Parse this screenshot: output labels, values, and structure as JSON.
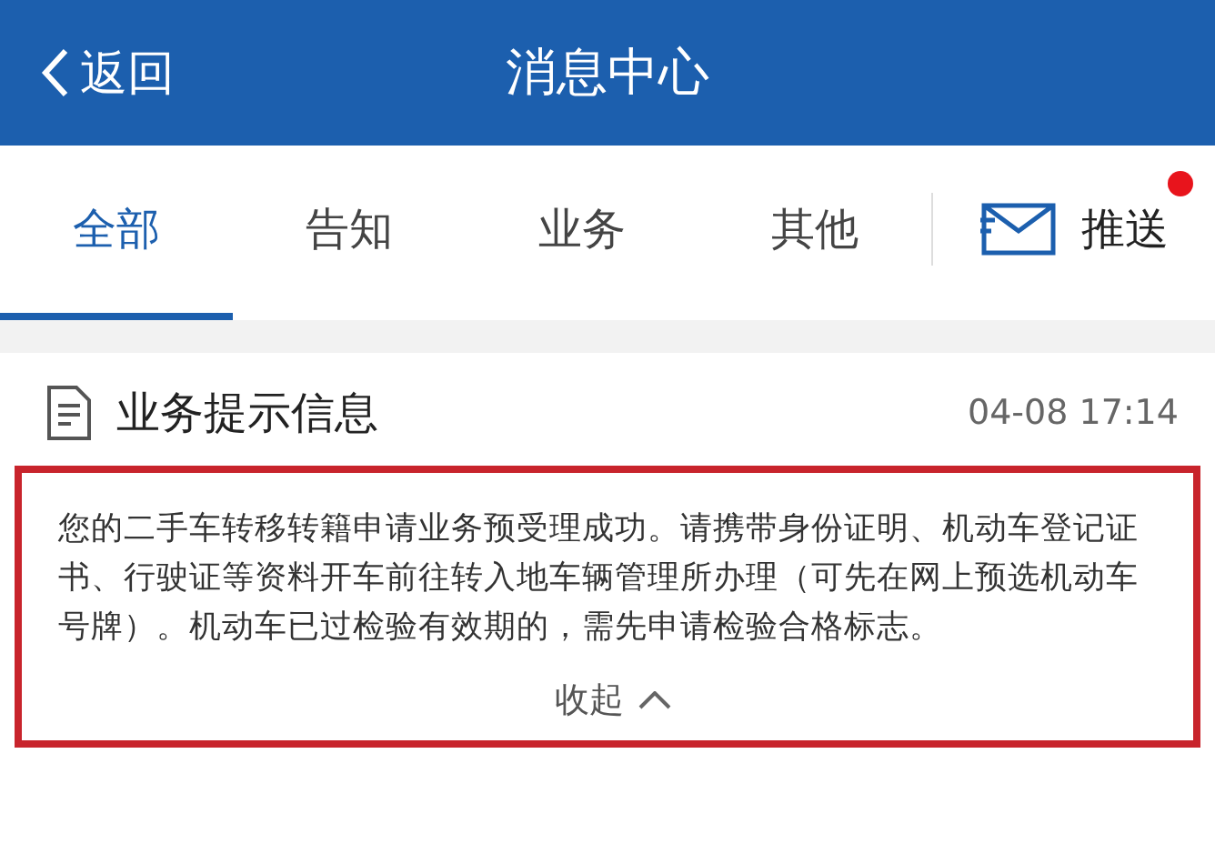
{
  "header": {
    "back": "返回",
    "title": "消息中心"
  },
  "tabs": [
    {
      "label": "全部",
      "selected": true
    },
    {
      "label": "告知",
      "selected": false
    },
    {
      "label": "业务",
      "selected": false
    },
    {
      "label": "其他",
      "selected": false
    }
  ],
  "push": {
    "label": "推送",
    "unread": true
  },
  "message": {
    "title": "业务提示信息",
    "time": "04-08 17:14",
    "body": "您的二手车转移转籍申请业务预受理成功。请携带身份证明、机动车登记证书、行驶证等资料开车前往转入地车辆管理所办理（可先在网上预选机动车号牌）。机动车已过检验有效期的，需先申请检验合格标志。",
    "highlighted": true,
    "collapse": "收起"
  }
}
